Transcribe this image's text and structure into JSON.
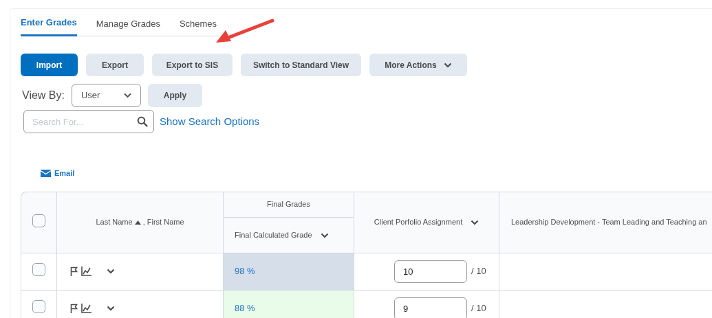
{
  "tabs": [
    {
      "label": "Enter Grades",
      "selected": true
    },
    {
      "label": "Manage Grades",
      "selected": false
    },
    {
      "label": "Schemes",
      "selected": false
    }
  ],
  "actions": [
    {
      "label": "Import",
      "kind": "primary"
    },
    {
      "label": "Export",
      "kind": "secondary"
    },
    {
      "label": "Export to SIS",
      "kind": "secondary"
    },
    {
      "label": "Switch to Standard View",
      "kind": "secondary"
    },
    {
      "label": "More Actions",
      "kind": "menu"
    }
  ],
  "view_by": {
    "label": "View By:",
    "value": "User",
    "apply": "Apply"
  },
  "search": {
    "placeholder": "Search For...",
    "options_link": "Show Search Options"
  },
  "email": "Email",
  "table": {
    "columns": {
      "name": "Last Name",
      "name_rest": ", First Name",
      "group": "Final Grades",
      "final": "Final Calculated Grade",
      "assignment": "Client Porfolio Assignment",
      "column_5": "Leadership Development - Team Leading and Teaching an"
    },
    "select_all_checked": false,
    "rows": [
      {
        "checked": false,
        "grade": "98 %",
        "color": "#d6deea",
        "score": "10",
        "out_of": "/ 10"
      },
      {
        "checked": false,
        "grade": "88 %",
        "color": "#e9fce9",
        "score": "9",
        "out_of": "/ 10"
      }
    ]
  }
}
